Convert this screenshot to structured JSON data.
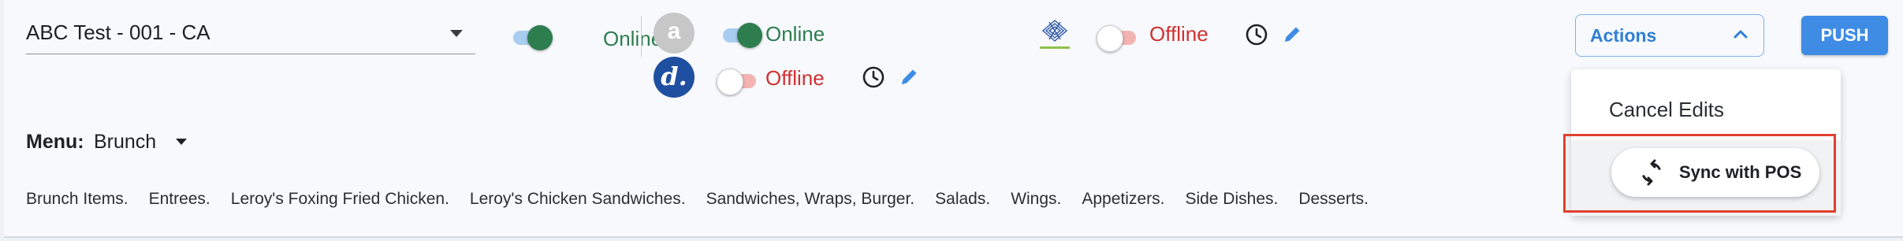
{
  "location": {
    "name": "ABC Test - 001 - CA"
  },
  "channels": [
    {
      "status": "Online"
    },
    {
      "status": "Online",
      "avatar_letter": "a"
    },
    {
      "status": "Offline",
      "avatar_letter": "d."
    },
    {
      "status": "Offline"
    }
  ],
  "actions": {
    "label": "Actions",
    "menu_items": [
      "Cancel Edits",
      "Sync with POS"
    ]
  },
  "push": {
    "label": "PUSH"
  },
  "menu": {
    "label": "Menu:",
    "value": "Brunch"
  },
  "categories": [
    "Brunch Items.",
    "Entrees.",
    "Leroy's Foxing Fried Chicken.",
    "Leroy's Chicken Sandwiches.",
    "Sandwiches, Wraps, Burger.",
    "Salads.",
    "Wings.",
    "Appetizers.",
    "Side Dishes.",
    "Desserts."
  ],
  "colors": {
    "online": "#2e7d4f",
    "offline": "#d32f2f",
    "accent": "#3e8ce4",
    "highlight": "#e0402d"
  },
  "icons": [
    "clock-icon",
    "pencil-icon",
    "sync-icon",
    "chevron-up-icon",
    "caret-down-icon"
  ]
}
